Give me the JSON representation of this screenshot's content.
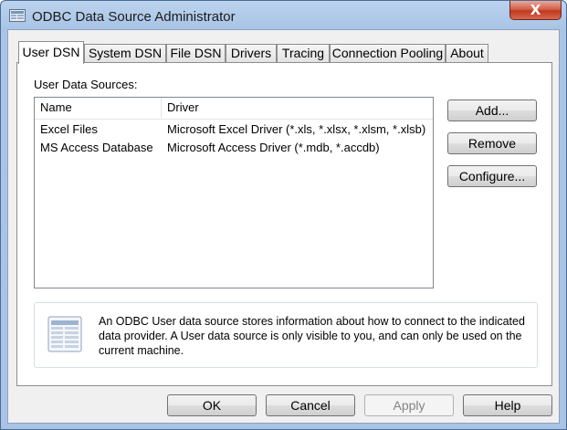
{
  "window": {
    "title": "ODBC Data Source Administrator",
    "close_glyph": "X",
    "icon": "odbc-app-icon"
  },
  "tabs": [
    {
      "label": "User DSN",
      "active": true
    },
    {
      "label": "System DSN",
      "active": false
    },
    {
      "label": "File DSN",
      "active": false
    },
    {
      "label": "Drivers",
      "active": false
    },
    {
      "label": "Tracing",
      "active": false
    },
    {
      "label": "Connection Pooling",
      "active": false
    },
    {
      "label": "About",
      "active": false
    }
  ],
  "panel": {
    "sources_label": "User Data Sources:",
    "columns": [
      "Name",
      "Driver"
    ],
    "rows": [
      {
        "name": "Excel Files",
        "driver": "Microsoft Excel Driver (*.xls, *.xlsx, *.xlsm, *.xlsb)",
        "selected": true
      },
      {
        "name": "MS Access Database",
        "driver": "Microsoft Access Driver (*.mdb, *.accdb)",
        "selected": false
      }
    ],
    "buttons": {
      "add": "Add...",
      "remove": "Remove",
      "configure": "Configure..."
    },
    "info": {
      "icon": "datasource-info-icon",
      "text": "An ODBC User data source stores information about how to connect to the indicated data provider.   A User data source is only visible to you, and can only be used on the current machine."
    }
  },
  "footer": {
    "ok": "OK",
    "cancel": "Cancel",
    "apply": "Apply",
    "apply_enabled": false,
    "help": "Help"
  },
  "colors": {
    "title_bar": "#a9c4e6",
    "close_button": "#c0391f",
    "dialog_face": "#f0f0f0"
  }
}
